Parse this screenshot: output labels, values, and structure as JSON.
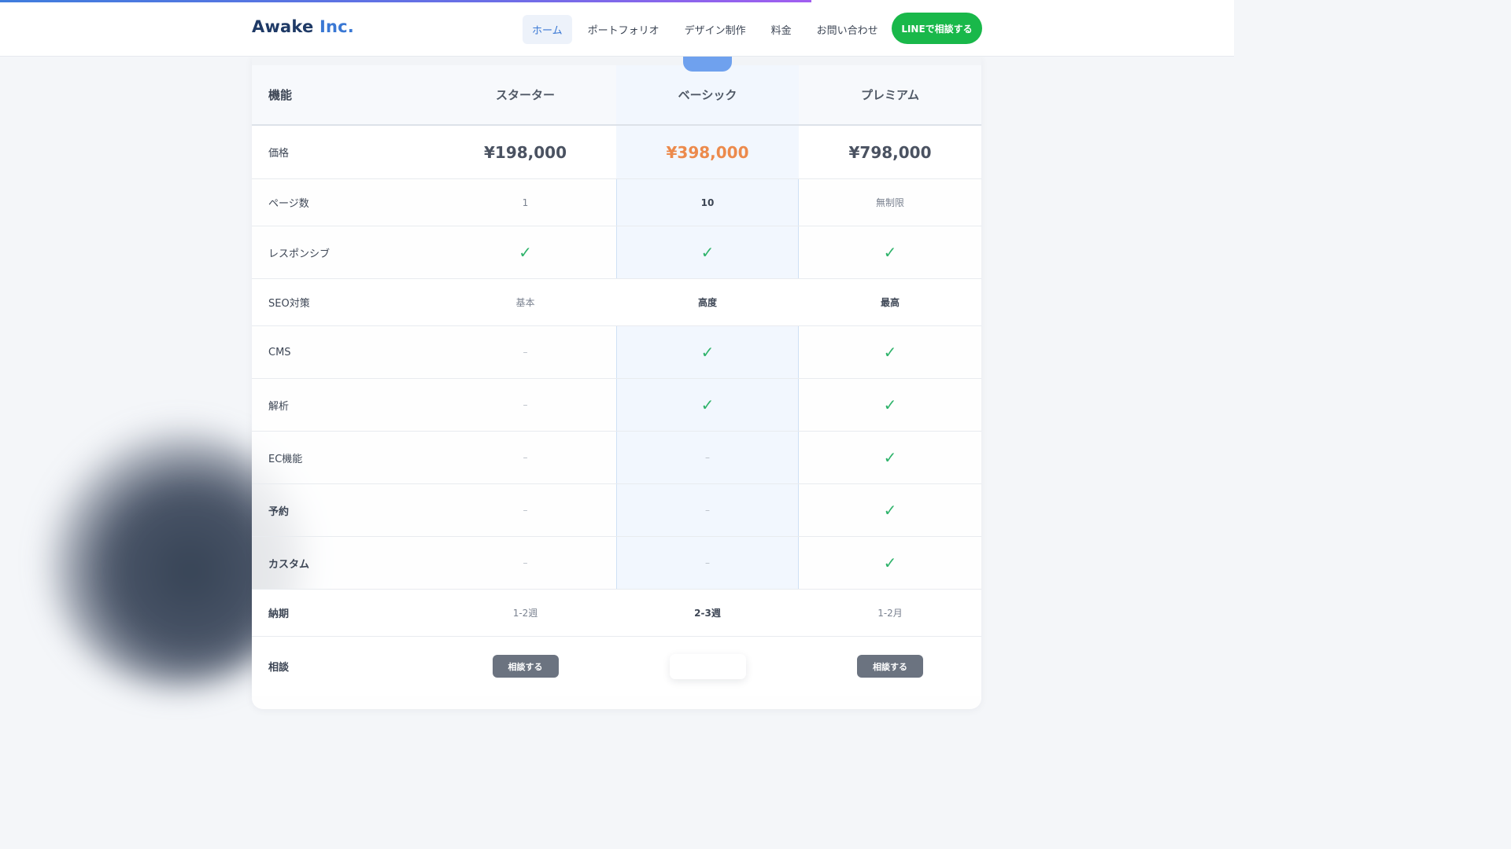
{
  "header": {
    "logo_main": "Awake",
    "logo_accent": "Inc.",
    "nav": [
      "ホーム",
      "ポートフォリオ",
      "デザイン制作",
      "料金",
      "お問い合わせ"
    ],
    "cta": "LINEで相談する"
  },
  "table": {
    "header": [
      "機能",
      "スターター",
      "ベーシック",
      "プレミアム"
    ],
    "price": {
      "label": "価格",
      "values": [
        "¥198,000",
        "¥398,000",
        "¥798,000"
      ]
    },
    "pages": {
      "label": "ページ数",
      "values": [
        "1",
        "10",
        "無制限"
      ]
    },
    "responsive": {
      "label": "レスポンシブ",
      "values": [
        "✓",
        "✓",
        "✓"
      ]
    },
    "seo": {
      "label": "SEO対策",
      "values": [
        "基本",
        "高度",
        "最高"
      ]
    },
    "cms": {
      "label": "CMS",
      "values": [
        "–",
        "✓",
        "✓"
      ]
    },
    "analytics": {
      "label": "解析",
      "values": [
        "–",
        "✓",
        "✓"
      ]
    },
    "ec": {
      "label": "EC機能",
      "values": [
        "–",
        "–",
        "✓"
      ]
    },
    "booking": {
      "label": "予約",
      "values": [
        "–",
        "–",
        "✓"
      ]
    },
    "custom": {
      "label": "カスタム",
      "values": [
        "–",
        "–",
        "✓"
      ]
    },
    "delivery": {
      "label": "納期",
      "values": [
        "1-2週",
        "2-3週",
        "1-2月"
      ]
    },
    "consult": {
      "label": "相談",
      "button": "相談する"
    }
  },
  "colors": {
    "accent": "#3a78d4",
    "line_green": "#19b84a",
    "highlight_price": "#ec8a4c",
    "check": "#2fb36b"
  }
}
